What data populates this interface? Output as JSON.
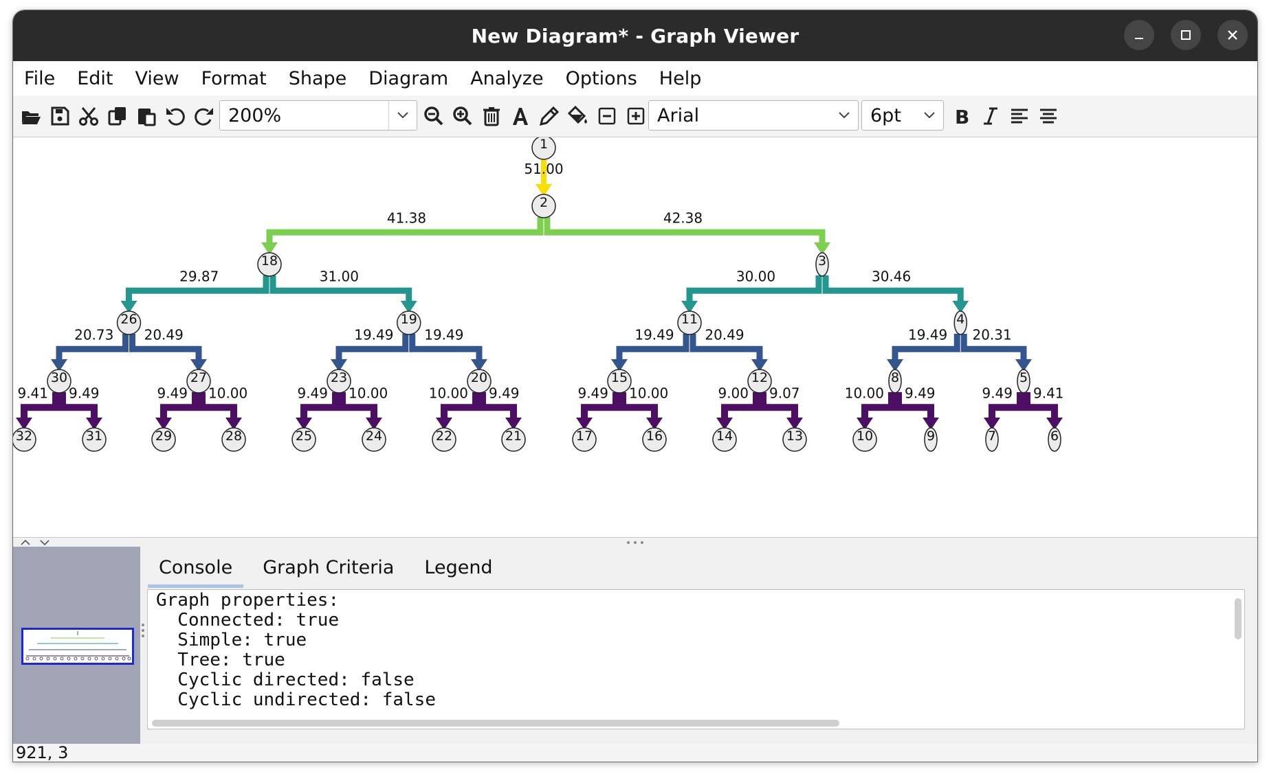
{
  "window": {
    "title": "New Diagram* - Graph Viewer"
  },
  "menu": {
    "items": [
      "File",
      "Edit",
      "View",
      "Format",
      "Shape",
      "Diagram",
      "Analyze",
      "Options",
      "Help"
    ]
  },
  "toolbar": {
    "zoom_value": "200%",
    "font_value": "Arial",
    "size_value": "6pt",
    "icons": [
      "open-icon",
      "save-icon",
      "cut-icon",
      "copy-icon",
      "paste-icon",
      "undo-icon",
      "redo-icon",
      "zoom-out-icon",
      "zoom-in-icon",
      "delete-icon",
      "text-icon",
      "pencil-icon",
      "fill-icon",
      "collapse-icon",
      "expand-icon",
      "bold-icon",
      "italic-icon",
      "align-left-icon",
      "align-center-icon"
    ]
  },
  "graph": {
    "edge_colors": {
      "1": "#f5e000",
      "2": "#7ccf4f",
      "3": "#23978f",
      "4": "#34568f",
      "5": "#4c0f63"
    },
    "nodes": [
      "1",
      "2",
      "18",
      "3",
      "26",
      "19",
      "11",
      "4",
      "30",
      "27",
      "23",
      "20",
      "15",
      "12",
      "8",
      "5",
      "32",
      "31",
      "29",
      "28",
      "25",
      "24",
      "22",
      "21",
      "17",
      "16",
      "14",
      "13",
      "10",
      "9",
      "7",
      "6"
    ],
    "edges": [
      {
        "from": "1",
        "to": "2",
        "label": "51.00",
        "level": 1
      },
      {
        "from": "2",
        "to": "18",
        "label": "41.38",
        "level": 2
      },
      {
        "from": "2",
        "to": "3",
        "label": "42.38",
        "level": 2
      },
      {
        "from": "18",
        "to": "26",
        "label": "29.87",
        "level": 3
      },
      {
        "from": "18",
        "to": "19",
        "label": "31.00",
        "level": 3
      },
      {
        "from": "3",
        "to": "11",
        "label": "30.00",
        "level": 3
      },
      {
        "from": "3",
        "to": "4",
        "label": "30.46",
        "level": 3
      },
      {
        "from": "26",
        "to": "30",
        "label": "20.73",
        "level": 4
      },
      {
        "from": "26",
        "to": "27",
        "label": "20.49",
        "level": 4
      },
      {
        "from": "19",
        "to": "23",
        "label": "19.49",
        "level": 4
      },
      {
        "from": "19",
        "to": "20",
        "label": "19.49",
        "level": 4
      },
      {
        "from": "11",
        "to": "15",
        "label": "19.49",
        "level": 4
      },
      {
        "from": "11",
        "to": "12",
        "label": "20.49",
        "level": 4
      },
      {
        "from": "4",
        "to": "8",
        "label": "19.49",
        "level": 4
      },
      {
        "from": "4",
        "to": "5",
        "label": "20.31",
        "level": 4
      },
      {
        "from": "30",
        "to": "32",
        "label": "9.41",
        "level": 5
      },
      {
        "from": "30",
        "to": "31",
        "label": "9.49",
        "level": 5
      },
      {
        "from": "27",
        "to": "29",
        "label": "9.49",
        "level": 5
      },
      {
        "from": "27",
        "to": "28",
        "label": "10.00",
        "level": 5
      },
      {
        "from": "23",
        "to": "25",
        "label": "9.49",
        "level": 5
      },
      {
        "from": "23",
        "to": "24",
        "label": "10.00",
        "level": 5
      },
      {
        "from": "20",
        "to": "22",
        "label": "10.00",
        "level": 5
      },
      {
        "from": "20",
        "to": "21",
        "label": "9.49",
        "level": 5
      },
      {
        "from": "15",
        "to": "17",
        "label": "9.49",
        "level": 5
      },
      {
        "from": "15",
        "to": "16",
        "label": "10.00",
        "level": 5
      },
      {
        "from": "12",
        "to": "14",
        "label": "9.00",
        "level": 5
      },
      {
        "from": "12",
        "to": "13",
        "label": "9.07",
        "level": 5
      },
      {
        "from": "8",
        "to": "10",
        "label": "10.00",
        "level": 5
      },
      {
        "from": "8",
        "to": "9",
        "label": "9.49",
        "level": 5
      },
      {
        "from": "5",
        "to": "7",
        "label": "9.49",
        "level": 5
      },
      {
        "from": "5",
        "to": "6",
        "label": "9.41",
        "level": 5
      }
    ]
  },
  "panel": {
    "tabs": [
      "Console",
      "Graph Criteria",
      "Legend"
    ],
    "active_tab": "Console",
    "console_lines": [
      "Graph properties:",
      "  Connected: true",
      "  Simple: true",
      "  Tree: true",
      "  Cyclic directed: false",
      "  Cyclic undirected: false"
    ]
  },
  "status": {
    "coords": "921, 3"
  }
}
